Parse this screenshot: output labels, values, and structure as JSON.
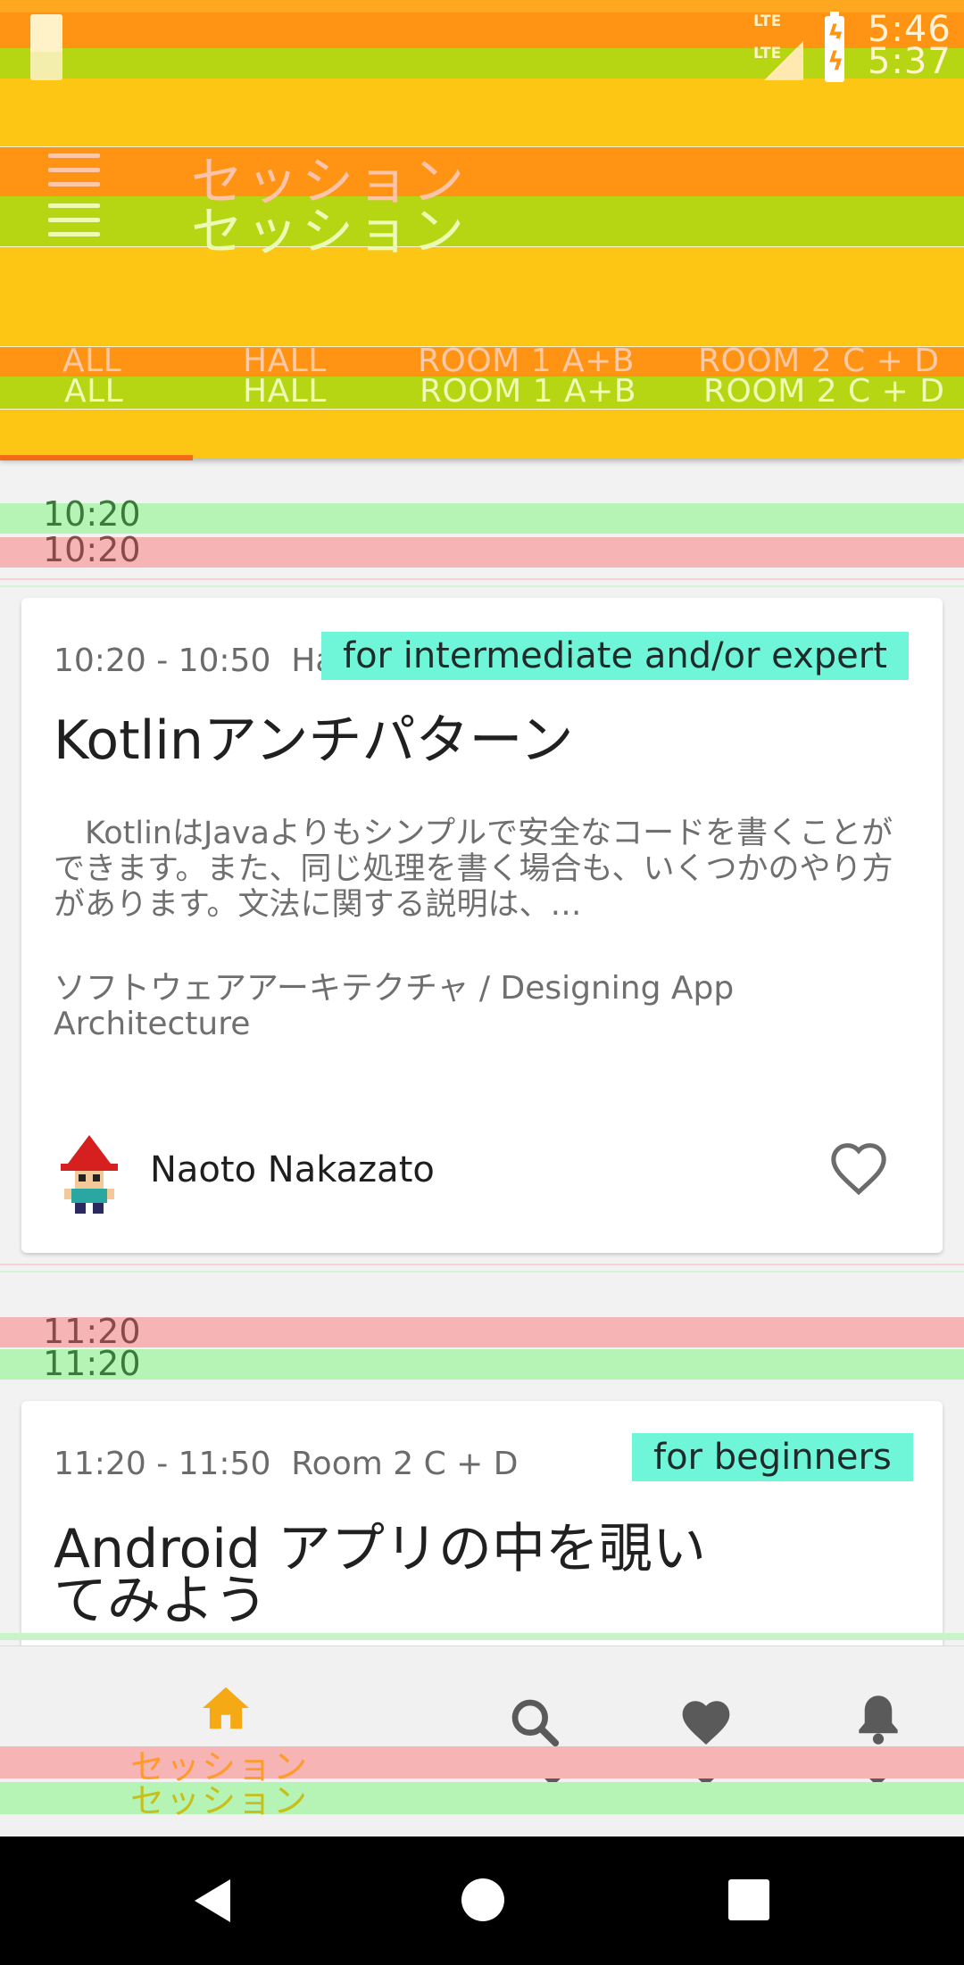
{
  "status_bar": {
    "time_top": "5:46",
    "time_bottom": "5:37",
    "network_top": "LTE",
    "network_bottom": "LTE"
  },
  "app_bar": {
    "title_top": "セッション",
    "title_bottom": "セッション"
  },
  "tabs_top": [
    "ALL",
    "HALL",
    "ROOM 1 A+B",
    "ROOM 2 C + D"
  ],
  "tabs_bottom": [
    "ALL",
    "HALL",
    "ROOM 1 A+B",
    "ROOM 2 C + D"
  ],
  "time_headers": {
    "first_top": "10:20",
    "first_bottom": "10:20",
    "second_top": "11:20",
    "second_bottom": "11:20"
  },
  "sessions": [
    {
      "time_range": "10:20 - 10:50",
      "room": "Ha",
      "level": "for intermediate and/or expert",
      "title": "Kotlinアンチパターン",
      "description": "　KotlinはJavaよりもシンプルで安全なコードを書くことができます。また、同じ処理を書く場合も、いくつかのやり方があります。文法に関する説明は、…",
      "topic": "ソフトウェアアーキテクチャ / Designing App Architecture",
      "speaker": "Naoto Nakazato"
    },
    {
      "time_range": "11:20 - 11:50",
      "room": "Room 2 C + D",
      "level": "for beginners",
      "title_line1": "Android アプリの中を覗い",
      "title_line2": "てみよう"
    }
  ],
  "bottom_nav": {
    "label_top": "セッション",
    "label_bottom": "セッション",
    "icons": [
      "home-icon",
      "search-icon",
      "heart-icon",
      "bell-icon"
    ]
  },
  "colors": {
    "app_bar": "#fdc614",
    "band_orange": "#ff9314",
    "band_green": "#b6d512",
    "badge": "#6ff6d8",
    "tab_indicator": "#f36b16",
    "time_green": "#b6f4b6",
    "time_pink": "#f6b4b4"
  }
}
